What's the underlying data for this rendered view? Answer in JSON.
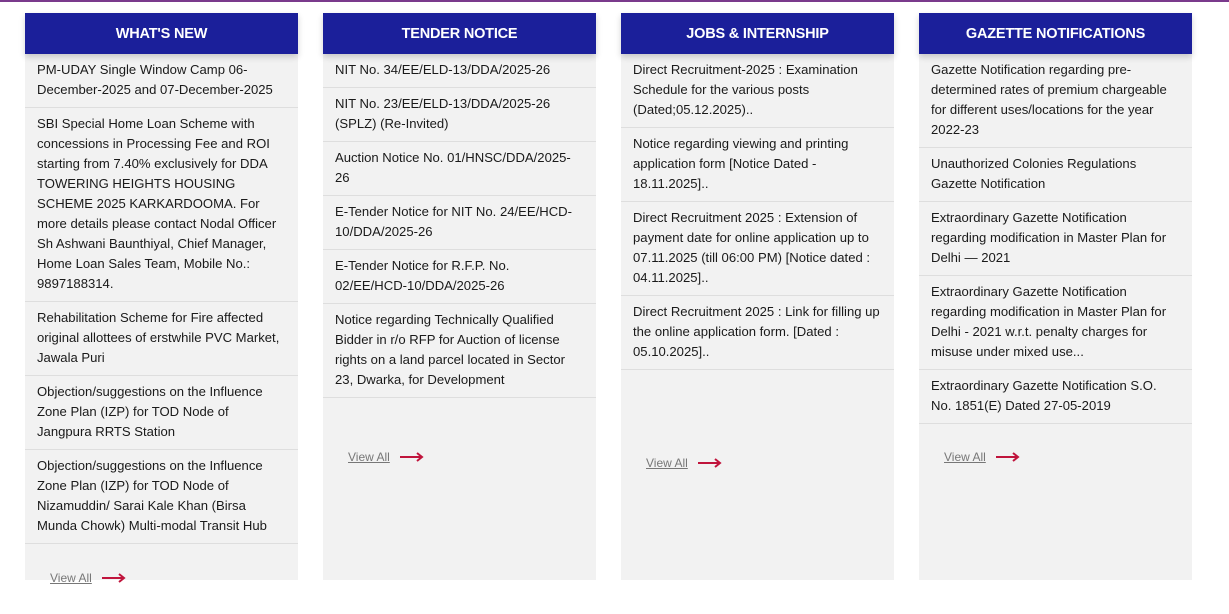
{
  "colors": {
    "header_bg": "#1b1f9a",
    "column_bg": "#f2f2f2",
    "arrow": "#c0143c",
    "top_rule": "#7a3a8c"
  },
  "icons": {
    "view_all_arrow": "long-right-arrow-icon"
  },
  "columns": [
    {
      "title": "WHAT'S NEW",
      "items": [
        "PM-UDAY Single Window Camp 06-December-2025 and 07-December-2025",
        "SBI Special Home Loan Scheme with concessions in Processing Fee and ROI starting from 7.40% exclusively for DDA TOWERING HEIGHTS HOUSING SCHEME 2025 KARKARDOOMA. For more details please contact Nodal Officer Sh Ashwani Baunthiyal, Chief Manager, Home Loan Sales Team, Mobile No.: 9897188314.",
        "Rehabilitation Scheme for Fire affected original allottees of erstwhile PVC Market, Jawala Puri",
        "Objection/suggestions on the Influence Zone Plan (IZP) for TOD Node of Jangpura RRTS Station",
        "Objection/suggestions on the Influence Zone Plan (IZP) for TOD Node of Nizamuddin/ Sarai Kale Khan (Birsa Munda Chowk) Multi-modal Transit Hub"
      ],
      "view_all": "View All"
    },
    {
      "title": "TENDER NOTICE",
      "items": [
        "NIT No. 34/EE/ELD-13/DDA/2025-26",
        "NIT No. 23/EE/ELD-13/DDA/2025-26 (SPLZ) (Re-Invited)",
        "Auction Notice No. 01/HNSC/DDA/2025-26",
        "E-Tender Notice for NIT No. 24/EE/HCD-10/DDA/2025-26",
        "E-Tender Notice for R.F.P. No. 02/EE/HCD-10/DDA/2025-26",
        "Notice regarding Technically Qualified Bidder in r/o RFP for Auction of license rights on a land parcel located in Sector 23, Dwarka, for Development"
      ],
      "view_all": "View All"
    },
    {
      "title": "JOBS & INTERNSHIP",
      "items": [
        "Direct Recruitment-2025 : Examination Schedule for the various posts (Dated;05.12.2025)..",
        "Notice regarding viewing and printing application form [Notice Dated - 18.11.2025]..",
        "Direct Recruitment 2025 : Extension of payment date for online application up to 07.11.2025 (till 06:00 PM) [Notice dated : 04.11.2025]..",
        "Direct Recruitment 2025 : Link for filling up the online application form. [Dated : 05.10.2025].."
      ],
      "view_all": "View All"
    },
    {
      "title": "GAZETTE NOTIFICATIONS",
      "items": [
        "Gazette Notification regarding pre-determined rates of premium chargeable for different uses/locations for the year 2022-23",
        "Unauthorized Colonies Regulations Gazette Notification",
        "Extraordinary Gazette Notification regarding modification in Master Plan for Delhi — 2021",
        "Extraordinary Gazette Notification regarding modification in Master Plan for Delhi - 2021 w.r.t. penalty charges for misuse under mixed use...",
        "Extraordinary Gazette Notification S.O. No. 1851(E) Dated 27-05-2019"
      ],
      "view_all": "View All"
    }
  ]
}
